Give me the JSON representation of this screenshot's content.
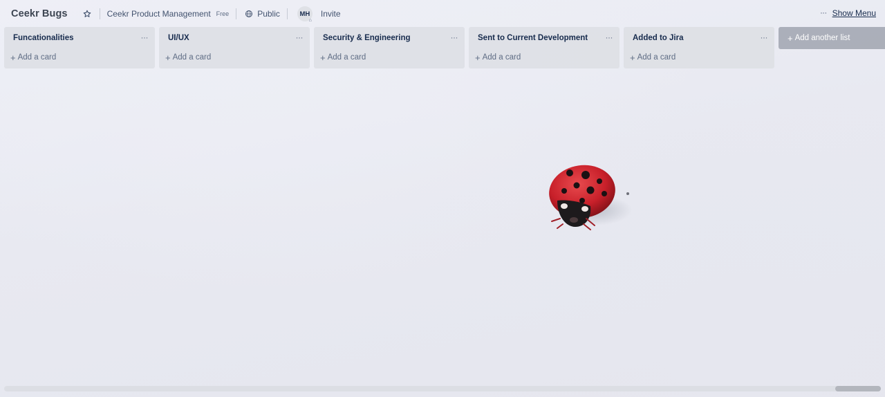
{
  "header": {
    "board_title": "Ceekr Bugs",
    "star_icon": "star-outline",
    "workspace_name": "Ceekr Product Management",
    "workspace_badge": "Free",
    "visibility_icon": "globe",
    "visibility": "Public",
    "avatar_initials": "MH",
    "invite_label": "Invite",
    "menu_dots": "···",
    "show_menu_label": "Show Menu"
  },
  "lists": [
    {
      "title": "Funcationalities",
      "menu": "···",
      "add_card": "Add a card"
    },
    {
      "title": "UI/UX",
      "menu": "···",
      "add_card": "Add a card"
    },
    {
      "title": "Security & Engineering",
      "menu": "···",
      "add_card": "Add a card"
    },
    {
      "title": "Sent to Current Development",
      "menu": "···",
      "add_card": "Add a card"
    },
    {
      "title": "Added to Jira",
      "menu": "···",
      "add_card": "Add a card"
    }
  ],
  "add_list_label": "Add another list",
  "plus_glyph": "+",
  "background": {
    "image": "ladybug on white paper",
    "ladybug_color": "#c8202a"
  }
}
